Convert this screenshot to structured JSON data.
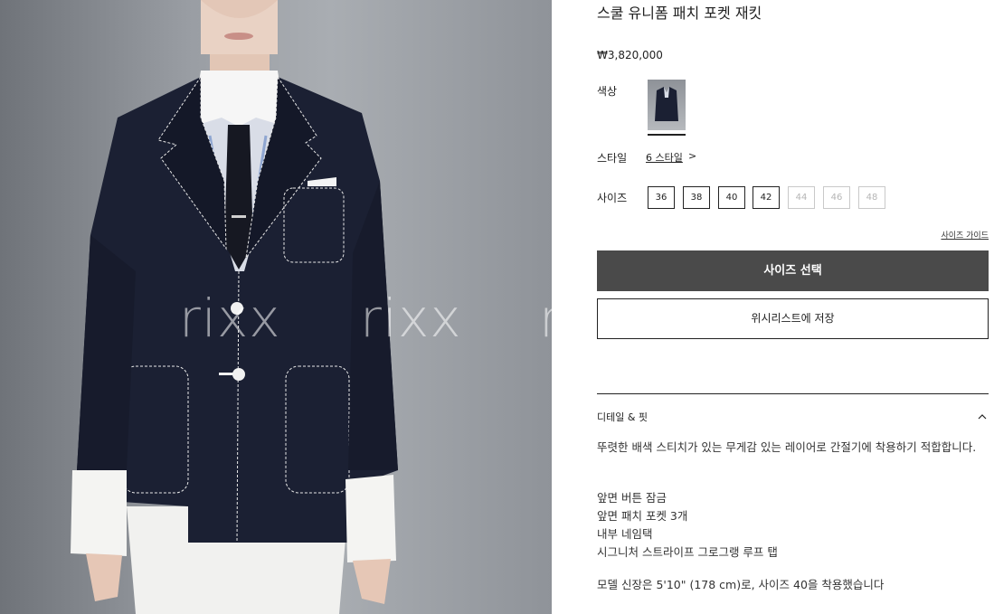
{
  "product": {
    "title": "스쿨 유니폼 패치 포켓 재킷",
    "price": "₩3,820,000"
  },
  "color": {
    "label": "색상"
  },
  "style": {
    "label": "스타일",
    "link": "6 스타일",
    "arrow": ">"
  },
  "size": {
    "label": "사이즈",
    "options": [
      {
        "label": "36",
        "available": true
      },
      {
        "label": "38",
        "available": true
      },
      {
        "label": "40",
        "available": true
      },
      {
        "label": "42",
        "available": true
      },
      {
        "label": "44",
        "available": false
      },
      {
        "label": "46",
        "available": false
      },
      {
        "label": "48",
        "available": false
      }
    ],
    "guide": "사이즈 가이드"
  },
  "buttons": {
    "select_size": "사이즈 선택",
    "wishlist": "위시리스트에 저장"
  },
  "details": {
    "title": "디테일 & 핏",
    "chevron": "^",
    "description": "뚜렷한 배색 스티치가 있는 무게감 있는 레이어로 간절기에 착용하기 적합합니다.",
    "features": [
      "앞면 버튼 잠금",
      "앞면 패치 포켓 3개",
      "내부 네임택",
      "시그니처 스트라이프 그로그랭 루프 탭"
    ],
    "model": "모델 신장은 5'10\" (178 cm)로, 사이즈 40을 착용했습니다"
  },
  "watermark": "rixx",
  "colors": {
    "primary_button": "#4a4a4a",
    "jacket": "#1b2033"
  }
}
